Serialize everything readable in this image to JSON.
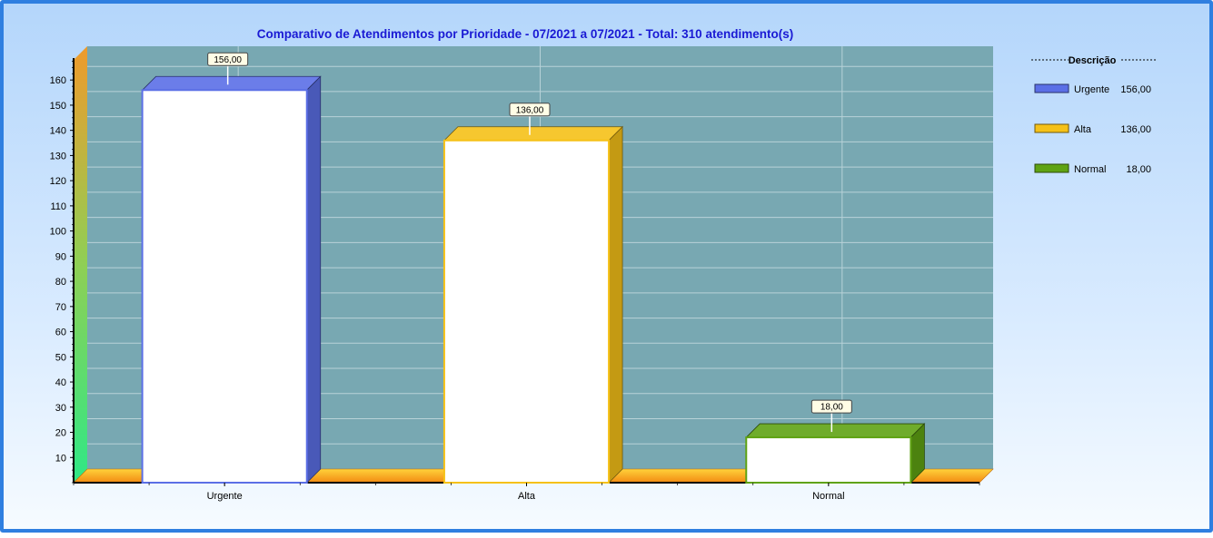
{
  "chart_data": {
    "type": "bar",
    "title": "Comparativo de Atendimentos por Prioridade - 07/2021 a 07/2021 - Total: 310 atendimento(s)",
    "categories": [
      "Urgente",
      "Alta",
      "Normal"
    ],
    "values": [
      156,
      136,
      18
    ],
    "data_labels": [
      "156,00",
      "136,00",
      "18,00"
    ],
    "colors": [
      "#5b6fe6",
      "#f5c118",
      "#5fa313"
    ],
    "ylim": [
      0,
      168
    ],
    "yticks": [
      10,
      20,
      30,
      40,
      50,
      60,
      70,
      80,
      90,
      100,
      110,
      120,
      130,
      140,
      150,
      160
    ],
    "xlabel": "",
    "ylabel": "",
    "grid": true,
    "plot_background": "#78a8b2",
    "legend": {
      "placement": "right",
      "title": "Descrição",
      "entries": [
        {
          "label": "Urgente",
          "value": "156,00"
        },
        {
          "label": "Alta",
          "value": "136,00"
        },
        {
          "label": "Normal",
          "value": "18,00"
        }
      ]
    }
  }
}
